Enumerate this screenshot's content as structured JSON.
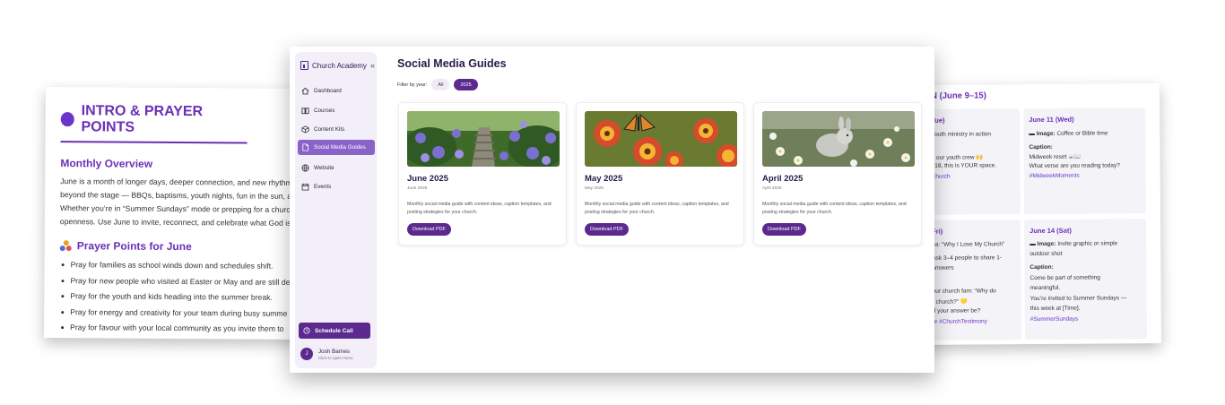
{
  "left_doc": {
    "title": "INTRO & PRAYER POINTS",
    "overview_heading": "Monthly Overview",
    "overview_lines": [
      "June is a month of longer days, deeper connection, and new rhythm",
      "beyond the stage — BBQs, baptisms, youth nights, fun in the sun, a",
      "Whether you’re in “Summer Sundays” mode or prepping for a churc",
      "openness. Use June to invite, reconnect, and celebrate what God is"
    ],
    "prayer_heading": "Prayer Points for June",
    "prayer_points": [
      "Pray for families as school winds down and schedules shift.",
      "Pray for new people who visited at Easter or May and are still de",
      "Pray for the youth and kids heading into the summer break.",
      "Pray for energy and creativity for your team during busy summe",
      "Pray for favour with your local community as you invite them to"
    ]
  },
  "right_doc": {
    "heading": "N (June 9–15)",
    "cells": [
      {
        "date": "Tue)",
        "lines": [
          "Youth ministry in action",
          "",
          "e our youth crew 🙌",
          "–18, this is YOUR space.",
          "Church"
        ]
      },
      {
        "date": "June 11 (Wed)",
        "image_label": "Image:",
        "image_text": "Coffee or Bible time",
        "caption_label": "Caption:",
        "lines": [
          "Midweek reset ☕📖",
          "What verse are you reading today?"
        ],
        "tag": "#MidweekMoments"
      },
      {
        "date": "Fri)",
        "lines": [
          "ea: “Why I Love My Church”",
          "Ask 3–4 people to share 1-",
          "answers",
          "",
          "our church fam: “Why do",
          "r church?” 💛",
          "d your answer be?",
          "fe #ChurchTestimony"
        ]
      },
      {
        "date": "June 14 (Sat)",
        "image_label": "Image:",
        "image_text": "Invite graphic or simple",
        "image_text2": "outdoor shot",
        "caption_label": "Caption:",
        "lines": [
          "Come be part of something",
          "meaningful.",
          "You’re invited to Summer Sundays —",
          "this week at [Time]."
        ],
        "tag": "#SummerSundays"
      }
    ]
  },
  "app": {
    "brand": "Church Academy",
    "collapse_icon": "«",
    "nav": [
      {
        "label": "Dashboard",
        "icon": "home-icon"
      },
      {
        "label": "Courses",
        "icon": "book-icon"
      },
      {
        "label": "Content Kits",
        "icon": "box-icon"
      },
      {
        "label": "Social Media Guides",
        "icon": "file-icon",
        "active": true
      },
      {
        "label": "Website",
        "icon": "globe-icon"
      },
      {
        "label": "Events",
        "icon": "calendar-icon"
      }
    ],
    "schedule_button": "Schedule Call",
    "user": {
      "initial": "J",
      "name": "Josh Barnes",
      "subtitle": "Click to open menu"
    },
    "page_title": "Social Media Guides",
    "filter_label": "Filter by year:",
    "filter_options": [
      "All",
      "2025"
    ],
    "filter_selected": "2025",
    "cards": [
      {
        "title": "June 2025",
        "subtitle": "June 2025",
        "description": "Monthly social media guide with content ideas, caption templates, and posting strategies for your church.",
        "button": "Download PDF",
        "image": "garden-steps-photo"
      },
      {
        "title": "May 2025",
        "subtitle": "May 2025",
        "description": "Monthly social media guide with content ideas, caption templates, and posting strategies for your church.",
        "button": "Download PDF",
        "image": "butterfly-flowers-photo"
      },
      {
        "title": "April 2025",
        "subtitle": "April 2025",
        "description": "Monthly social media guide with content ideas, caption templates, and posting strategies for your church.",
        "button": "Download PDF",
        "image": "bunny-daisies-photo"
      }
    ]
  },
  "colors": {
    "brand_purple": "#5c2a8f",
    "heading_purple": "#6b2fb8",
    "active_nav": "#8a63c9"
  }
}
